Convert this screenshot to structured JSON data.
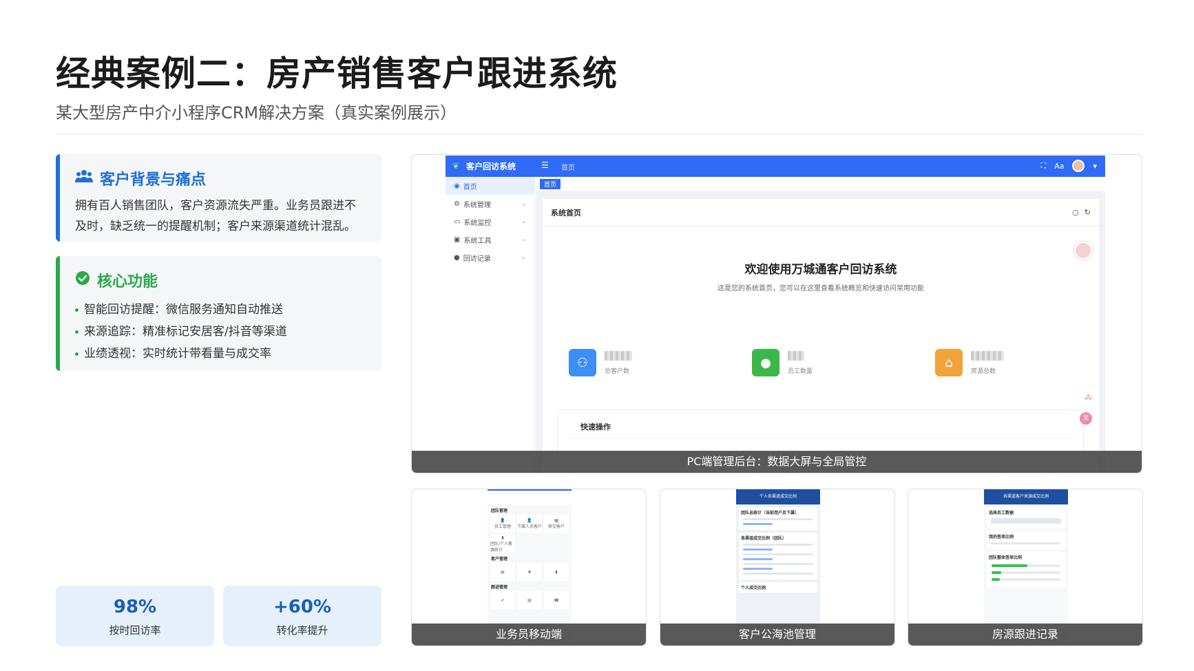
{
  "page": {
    "title": "经典案例二：房产销售客户跟进系统",
    "subtitle": "某大型房产中介小程序CRM解决方案（真实案例展示）"
  },
  "pain_card": {
    "heading": "客户背景与痛点",
    "icon": "users-icon",
    "text": "拥有百人销售团队，客户资源流失严重。业务员跟进不及时，缺乏统一的提醒机制；客户来源渠道统计混乱。"
  },
  "core_card": {
    "heading": "核心功能",
    "icon": "check-circle-icon",
    "features": [
      "智能回访提醒：微信服务通知自动推送",
      "来源追踪：精准标记安居客/抖音等渠道",
      "业绩透视：实时统计带看量与成交率"
    ]
  },
  "stats": [
    {
      "value": "98%",
      "label": "按时回访率"
    },
    {
      "value": "+60%",
      "label": "转化率提升"
    }
  ],
  "pc_screenshot": {
    "caption": "PC端管理后台：数据大屏与全局管控",
    "brand": "客户回访系统",
    "breadcrumb": "首页",
    "sidebar": [
      {
        "label": "首页",
        "icon": "palette-icon"
      },
      {
        "label": "系统管理",
        "icon": "gear-icon"
      },
      {
        "label": "系统监控",
        "icon": "monitor-icon"
      },
      {
        "label": "系统工具",
        "icon": "toolbox-icon"
      },
      {
        "label": "回访记录",
        "icon": "user-icon"
      }
    ],
    "tab": "首页",
    "panel_title": "系统首页",
    "welcome_title": "欢迎使用万城通客户回访系统",
    "welcome_sub": "这是您的系统首页，您可以在这里查看系统概览和快速访问常用功能",
    "kpis": [
      {
        "label": "总客户数",
        "icon": "user-icon",
        "color": "#3d8ef7"
      },
      {
        "label": "员工数量",
        "icon": "user-filled-icon",
        "color": "#3cb84a"
      },
      {
        "label": "房源总数",
        "icon": "house-icon",
        "color": "#f2a33a"
      }
    ],
    "quick_title": "快速操作"
  },
  "mobile_shots": [
    {
      "caption": "业务员移动端",
      "sections": [
        "团队管理",
        "客户管理",
        "跟进管理"
      ],
      "items": [
        "员工管理",
        "下属人员客户",
        "移交客户",
        "团队/个人客源统计"
      ]
    },
    {
      "caption": "客户公海池管理",
      "header": "个人各渠道成交比例",
      "sections": [
        "团队总统计（当前用户及下属）",
        "各渠道成交比例（团队）",
        "个人成交比例"
      ]
    },
    {
      "caption": "房源跟进记录",
      "header": "各渠道客户来源成交比例",
      "sections": [
        "选择员工数据",
        "我的签单比例",
        "团队整体签单比例"
      ]
    }
  ]
}
